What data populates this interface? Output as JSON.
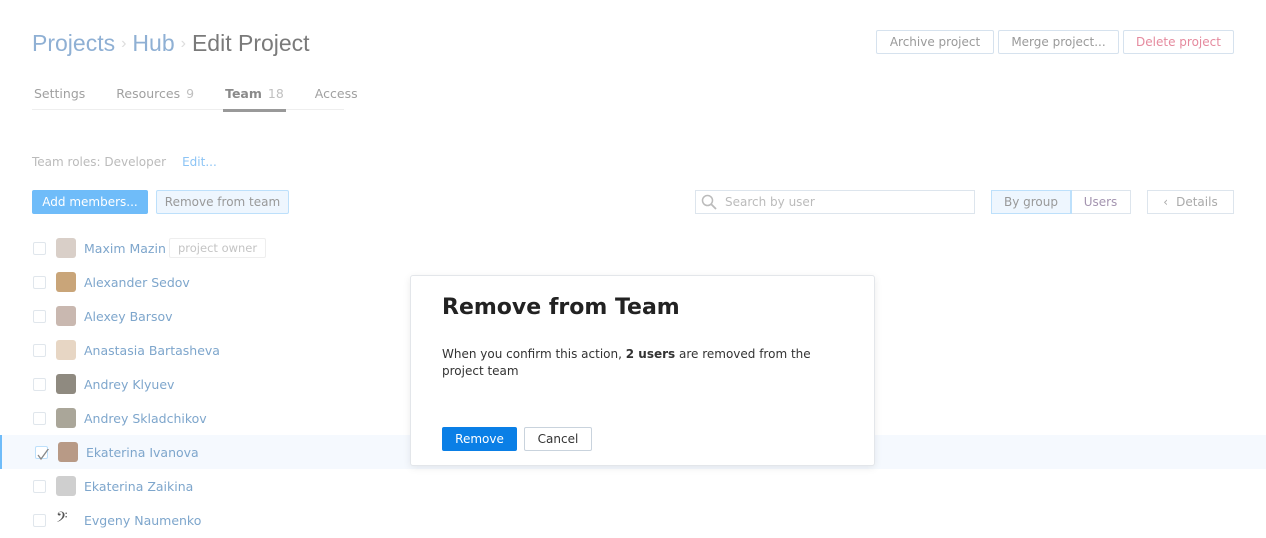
{
  "breadcrumb": {
    "items": [
      "Projects",
      "Hub"
    ],
    "current": "Edit Project"
  },
  "header_buttons": {
    "archive": "Archive project",
    "merge": "Merge project...",
    "delete": "Delete project"
  },
  "tabs": [
    {
      "label": "Settings",
      "count": ""
    },
    {
      "label": "Resources",
      "count": "9"
    },
    {
      "label": "Team",
      "count": "18"
    },
    {
      "label": "Access",
      "count": ""
    }
  ],
  "roles": {
    "text": "Team roles: Developer",
    "edit": "Edit..."
  },
  "toolbar": {
    "add": "Add members...",
    "remove": "Remove from team",
    "search_placeholder": "Search by user",
    "by_group": "By group",
    "users": "Users",
    "details": "Details"
  },
  "members": [
    {
      "name": "Maxim Mazin",
      "badge": "project owner",
      "checked": false,
      "color": "#d9cfc8"
    },
    {
      "name": "Alexander Sedov",
      "checked": false,
      "color": "#c9a579"
    },
    {
      "name": "Alexey Barsov",
      "checked": false,
      "color": "#c9b8b0"
    },
    {
      "name": "Anastasia Bartasheva",
      "checked": false,
      "color": "#e7d6c4"
    },
    {
      "name": "Andrey Klyuev",
      "checked": false,
      "color": "#8f8a80"
    },
    {
      "name": "Andrey Skladchikov",
      "checked": false,
      "color": "#aaa699"
    },
    {
      "name": "Ekaterina Ivanova",
      "checked": true,
      "color": "#b89a86"
    },
    {
      "name": "Ekaterina Zaikina",
      "checked": false,
      "color": "#cfcfcf"
    },
    {
      "name": "Evgeny Naumenko",
      "checked": false,
      "color": "#ffffff"
    }
  ],
  "modal": {
    "title": "Remove from Team",
    "text_before": "When you confirm this action, ",
    "text_bold": "2 users",
    "text_after": " are removed from the project team",
    "confirm": "Remove",
    "cancel": "Cancel"
  },
  "colors": {
    "accent": "#0a7fe6",
    "link": "#7ea6cc",
    "danger": "#e58a9e"
  }
}
